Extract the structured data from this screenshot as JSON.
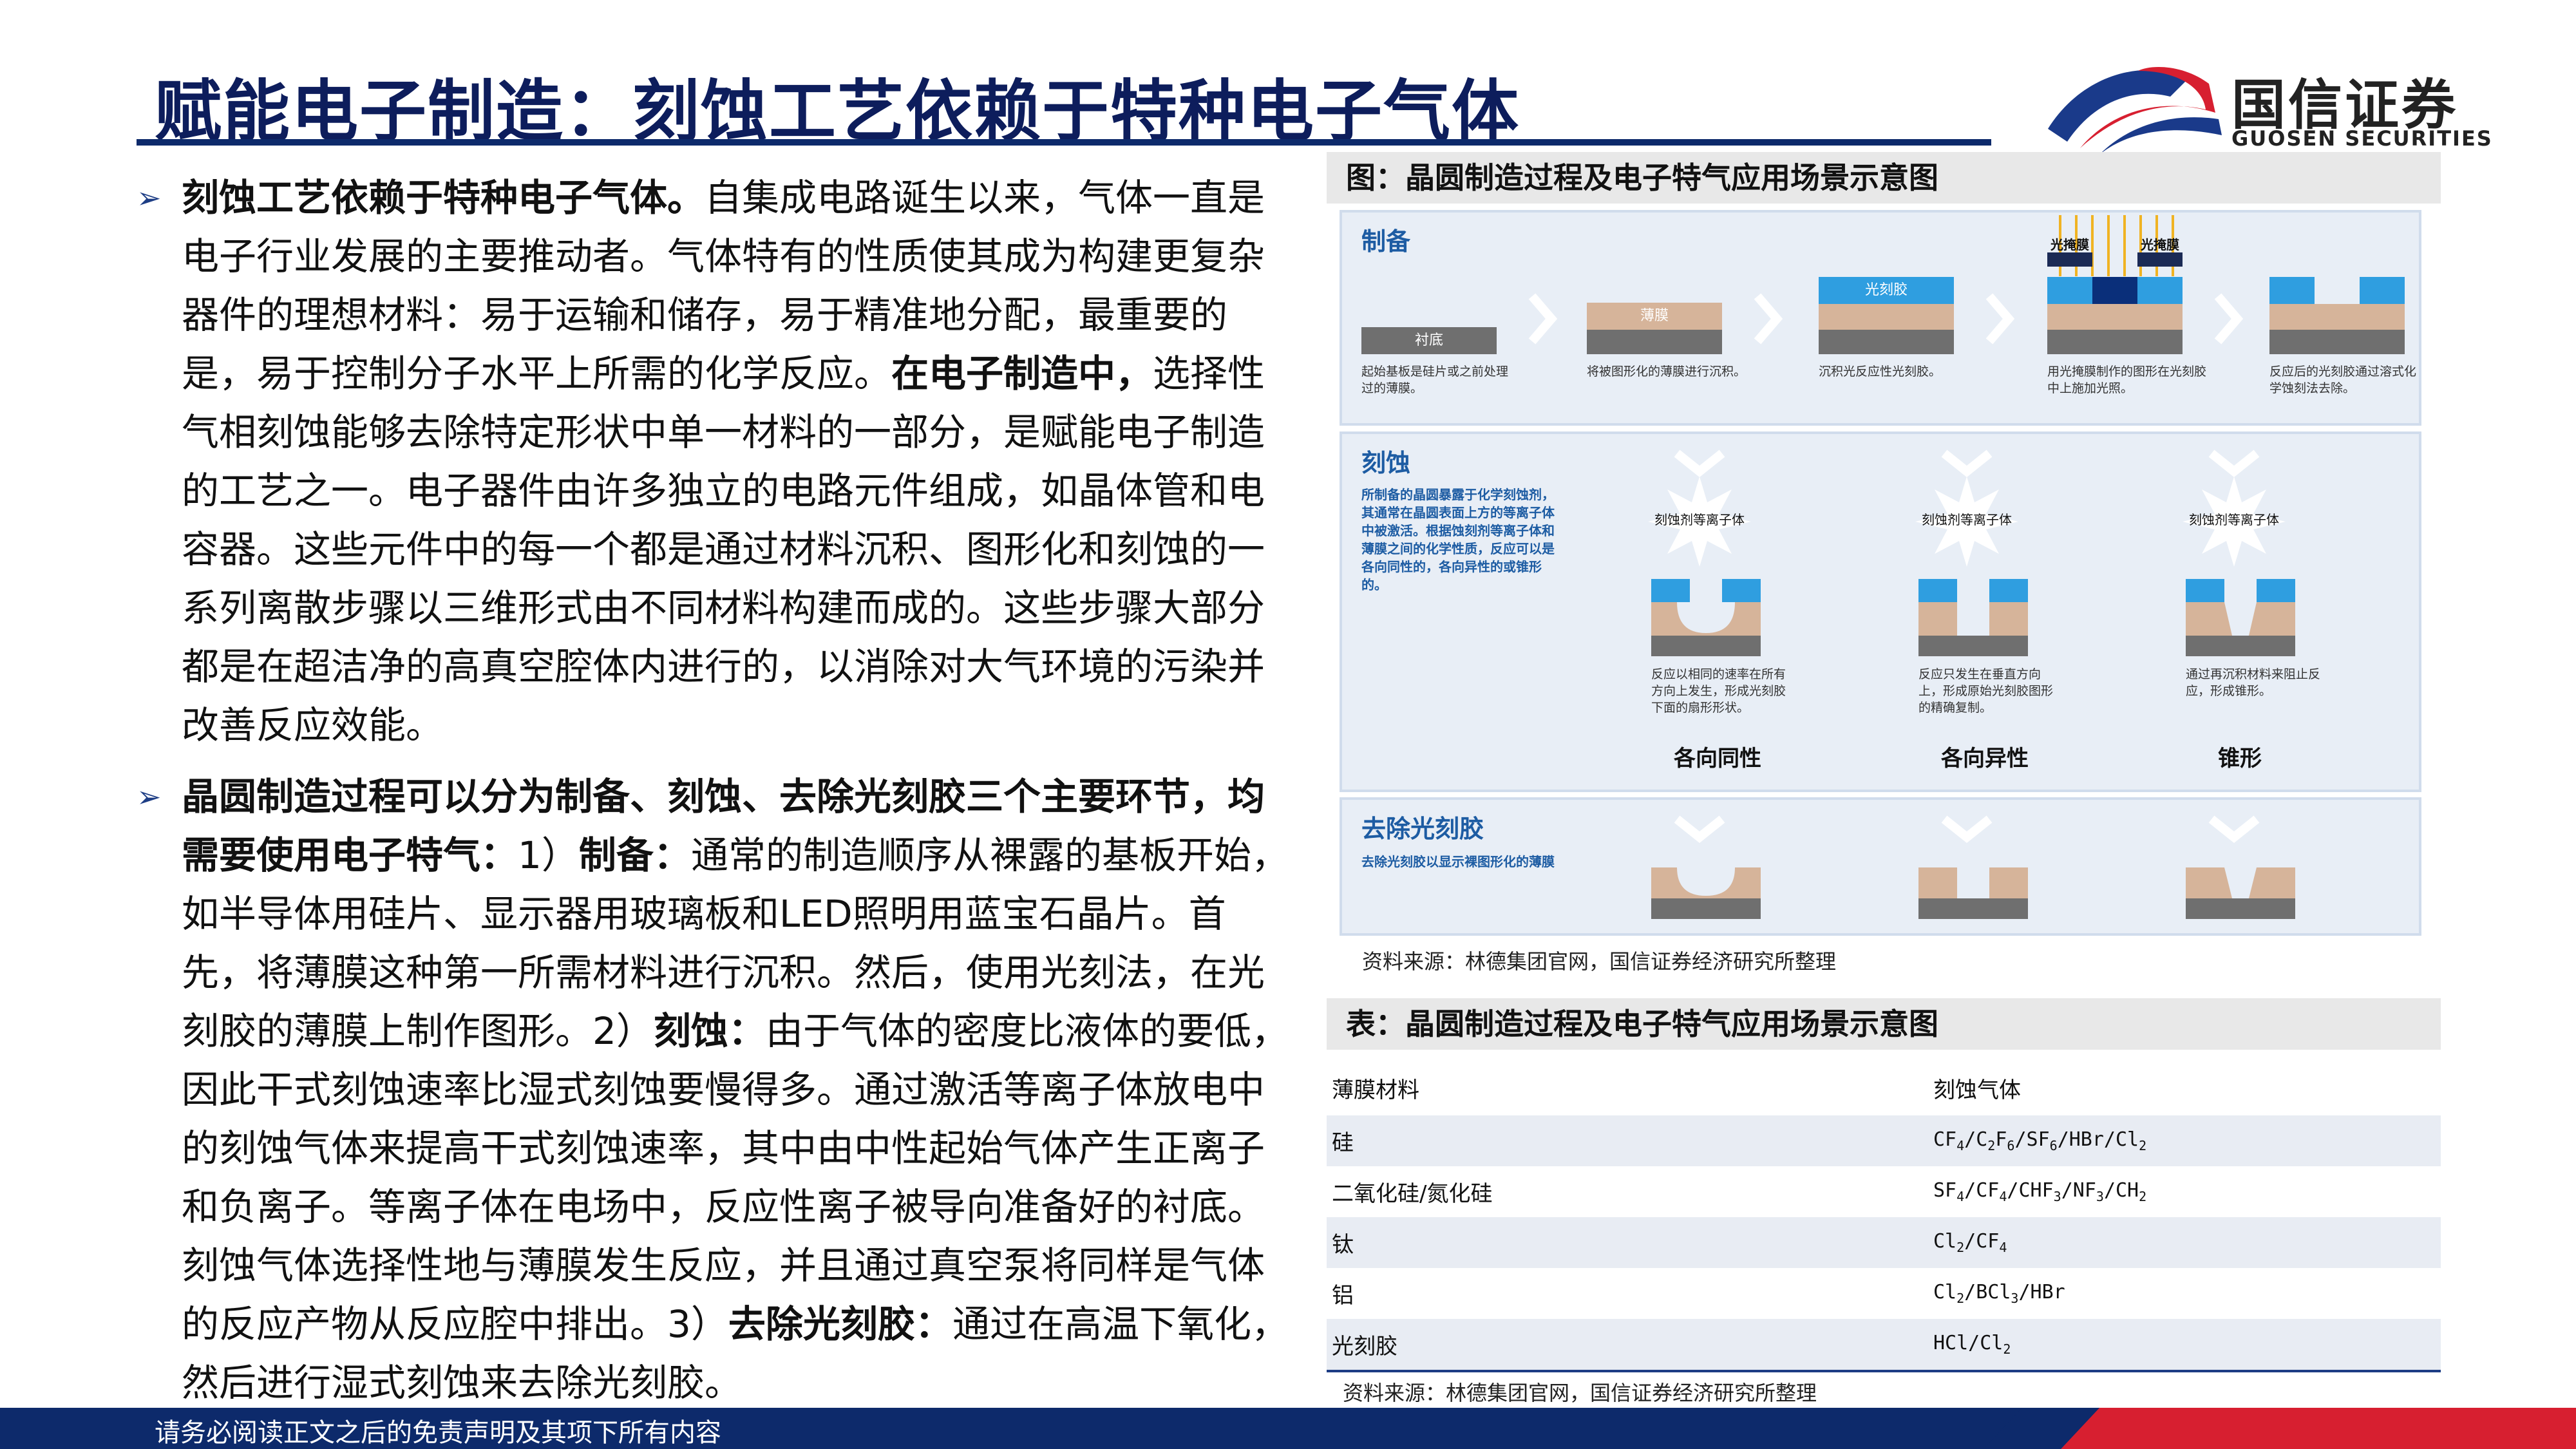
{
  "header": {
    "title": "赋能电子制造：刻蚀工艺依赖于特种电子气体",
    "logo_cn": "国信证券",
    "logo_en": "GUOSEN SECURITIES"
  },
  "paragraphs": [
    {
      "bullet": "➢",
      "lead": "刻蚀工艺依赖于特种电子气体。",
      "text1": "自集成电路诞生以来，气体一直是电子行业发展的主要推动者。气体特有的性质使其成为构建更复杂器件的理想材料：易于运输和储存，易于精准地分配，最重要的是，易于控制分子水平上所需的化学反应。",
      "mid_bold": "在电子制造中，",
      "text2": "选择性气相刻蚀能够去除特定形状中单一材料的一部分，是赋能电子制造的工艺之一。电子器件由许多独立的电路元件组成，如晶体管和电容器。这些元件中的每一个都是通过材料沉积、图形化和刻蚀的一系列离散步骤以三维形式由不同材料构建而成的。这些步骤大部分都是在超洁净的高真空腔体内进行的，以消除对大气环境的污染并改善反应效能。"
    },
    {
      "bullet": "➢",
      "lead": "晶圆制造过程可以分为制备、刻蚀、去除光刻胶三个主要环节，均需要使用电子特气：",
      "s1_num": "1）",
      "s1_bold": "制备：",
      "s1_text": "通常的制造顺序从裸露的基板开始，如半导体用硅片、显示器用玻璃板和LED照明用蓝宝石晶片。首先，将薄膜这种第一所需材料进行沉积。然后，使用光刻法，在光刻胶的薄膜上制作图形。",
      "s2_num": "2）",
      "s2_bold": "刻蚀：",
      "s2_text": "由于气体的密度比液体的要低，因此干式刻蚀速率比湿式刻蚀要慢得多。通过激活等离子体放电中的刻蚀气体来提高干式刻蚀速率，其中由中性起始气体产生正离子和负离子。等离子体在电场中，反应性离子被导向准备好的衬底。刻蚀气体选择性地与薄膜发生反应，并且通过真空泵将同样是气体的反应产物从反应腔中排出。",
      "s3_num": "3）",
      "s3_bold": "去除光刻胶：",
      "s3_text": "通过在高温下氧化，然后进行湿式刻蚀来去除光刻胶。"
    }
  ],
  "figure": {
    "caption": "图：晶圆制造过程及电子特气应用场景示意图",
    "prep": {
      "title": "制备",
      "substrate_label": "衬底",
      "film_label": "薄膜",
      "resist_label": "光刻胶",
      "mask_label": "光掩膜",
      "desc1": "起始基板是硅片或之前处理过的薄膜。",
      "desc2": "将被图形化的薄膜进行沉积。",
      "desc3": "沉积光反应性光刻胶。",
      "desc4": "用光掩膜制作的图形在光刻胶中上施加光照。",
      "desc5": "反应后的光刻胶通过溶式化学蚀刻法去除。"
    },
    "etch": {
      "title": "刻蚀",
      "desc": "所制备的晶圆暴露于化学刻蚀剂，其通常在晶圆表面上方的等离子体中被激活。根据蚀刻剂等离子体和薄膜之间的化学性质，反应可以是各向同性的，各向异性的或锥形的。",
      "plasma_label": "刻蚀剂等离子体",
      "desc_iso": "反应以相同的速率在所有方向上发生，形成光刻胶下面的扇形形状。",
      "desc_aniso": "反应只发生在垂直方向上，形成原始光刻胶图形的精确复制。",
      "desc_taper": "通过再沉积材料来阻止反应，形成锥形。",
      "label_iso": "各向同性",
      "label_aniso": "各向异性",
      "label_taper": "锥形"
    },
    "strip": {
      "title": "去除光刻胶",
      "desc": "去除光刻胶以显示裸图形化的薄膜"
    },
    "source": "资料来源：林德集团官网，国信证券经济研究所整理"
  },
  "table": {
    "caption": "表：晶圆制造过程及电子特气应用场景示意图",
    "headers": [
      "薄膜材料",
      "刻蚀气体"
    ],
    "rows": [
      {
        "material": "硅"
      },
      {
        "material": "二氧化硅/氮化硅"
      },
      {
        "material": "钛"
      },
      {
        "material": "铝"
      },
      {
        "material": "光刻胶"
      }
    ],
    "source": "资料来源：林德集团官网，国信证券经济研究所整理"
  },
  "footer": {
    "text": "请务必阅读正文之后的免责声明及其项下所有内容"
  },
  "colors": {
    "navy": "#0d2a6b",
    "accent_red": "#d71f30",
    "diagram_blue": "#1d5ca3",
    "resist_blue": "#2f9ee0",
    "film_tan": "#d6b49a"
  }
}
